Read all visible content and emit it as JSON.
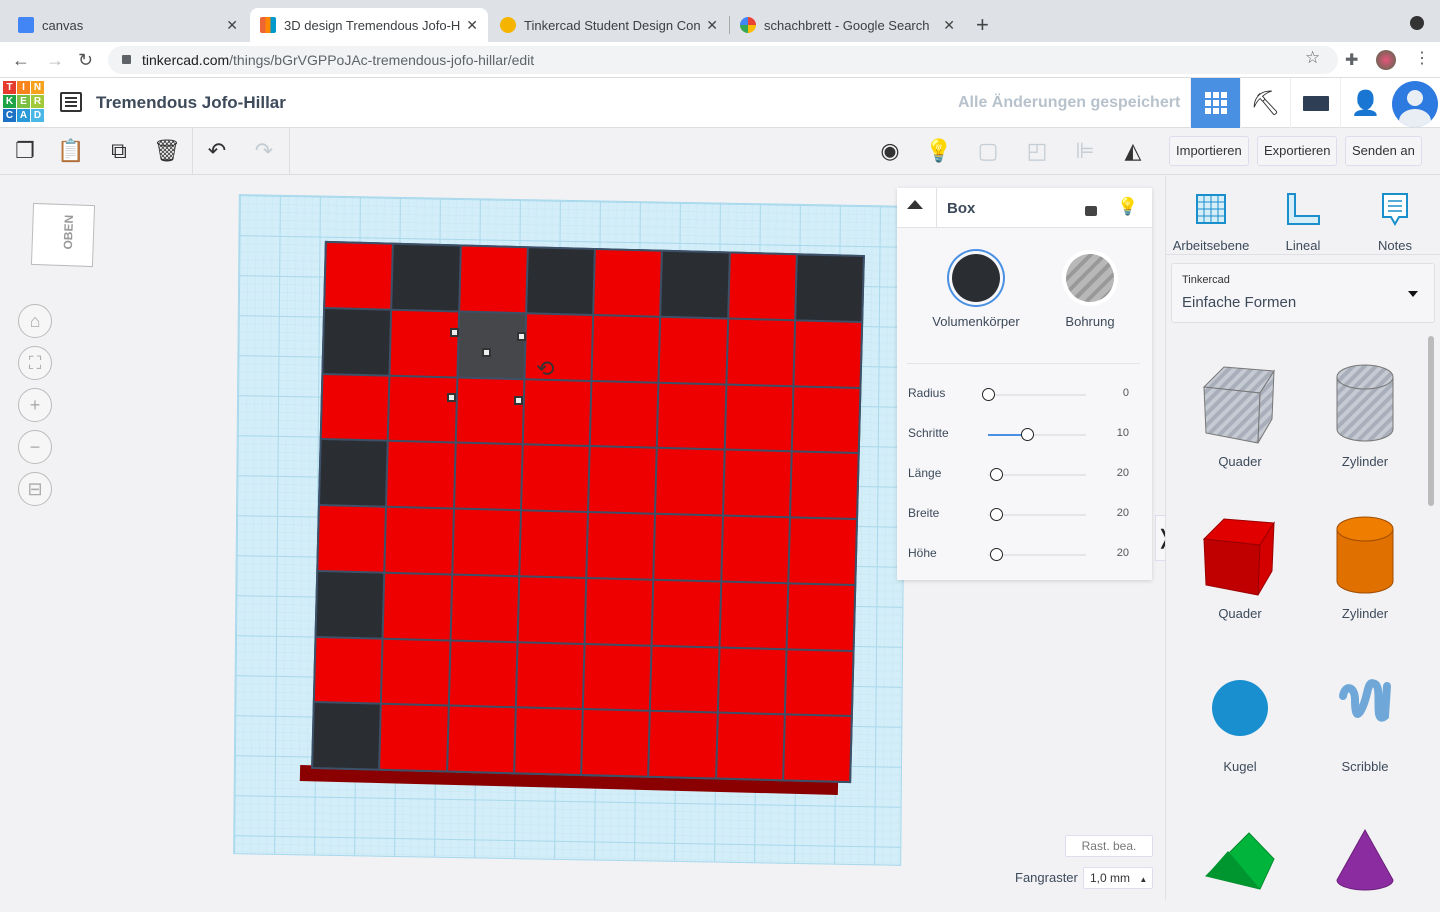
{
  "browser": {
    "tabs": [
      {
        "title": "canvas",
        "active": false
      },
      {
        "title": "3D design Tremendous Jofo-H",
        "active": true
      },
      {
        "title": "Tinkercad Student Design Con",
        "active": false
      },
      {
        "title": "schachbrett - Google Search",
        "active": false
      }
    ],
    "url_host": "tinkercad.com",
    "url_path": "/things/bGrVGPPoJAc-tremendous-jofo-hillar/edit"
  },
  "header": {
    "logo_letters": [
      "T",
      "I",
      "N",
      "K",
      "E",
      "R",
      "C",
      "A",
      "D"
    ],
    "design_title": "Tremendous Jofo-Hillar",
    "save_status": "Alle Änderungen gespeichert"
  },
  "toolbar": {
    "import": "Importieren",
    "export": "Exportieren",
    "send": "Senden an"
  },
  "viewcube": {
    "face": "OBEN"
  },
  "workplane": {
    "label": "Arbeitsebene"
  },
  "board": {
    "rows": 8,
    "cols": 8,
    "colors": {
      "red": "#ee0000",
      "dark": "#2a2e33",
      "selected": "#45474b"
    },
    "dark_cells": [
      [
        0,
        1
      ],
      [
        0,
        3
      ],
      [
        0,
        5
      ],
      [
        0,
        7
      ],
      [
        1,
        0
      ],
      [
        3,
        0
      ],
      [
        5,
        0
      ],
      [
        7,
        0
      ]
    ],
    "selected_cell": [
      1,
      2
    ]
  },
  "inspector": {
    "title": "Box",
    "solid_label": "Volumenkörper",
    "hole_label": "Bohrung",
    "params": [
      {
        "label": "Radius",
        "value": "0",
        "fraction": 0.0
      },
      {
        "label": "Schritte",
        "value": "10",
        "fraction": 0.4
      },
      {
        "label": "Länge",
        "value": "20",
        "fraction": 0.08
      },
      {
        "label": "Breite",
        "value": "20",
        "fraction": 0.08
      },
      {
        "label": "Höhe",
        "value": "20",
        "fraction": 0.08
      }
    ]
  },
  "grid": {
    "edit_label": "Rast. bea.",
    "snap_label": "Fangraster",
    "snap_value": "1,0 mm"
  },
  "rightpanel": {
    "tools": [
      {
        "label": "Arbeitsebene",
        "icon": "workplane-icon"
      },
      {
        "label": "Lineal",
        "icon": "ruler-icon"
      },
      {
        "label": "Notes",
        "icon": "notes-icon"
      }
    ],
    "library_source": "Tinkercad",
    "library_name": "Einfache Formen",
    "shapes": [
      {
        "label": "Quader",
        "kind": "box-hole"
      },
      {
        "label": "Zylinder",
        "kind": "cylinder-hole"
      },
      {
        "label": "Quader",
        "kind": "box"
      },
      {
        "label": "Zylinder",
        "kind": "cylinder"
      },
      {
        "label": "Kugel",
        "kind": "sphere"
      },
      {
        "label": "Scribble",
        "kind": "scribble"
      },
      {
        "label": "",
        "kind": "roof"
      },
      {
        "label": "",
        "kind": "cone"
      }
    ]
  }
}
